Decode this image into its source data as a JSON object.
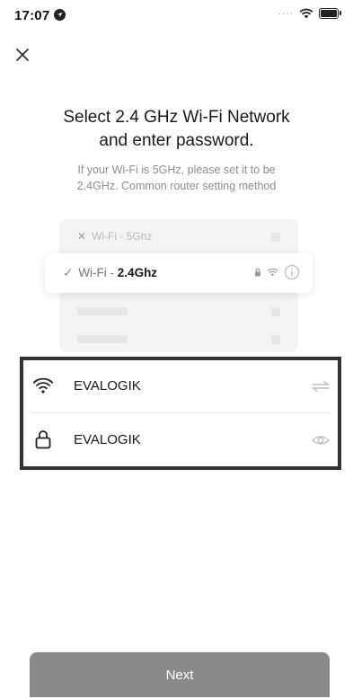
{
  "status_bar": {
    "time": "17:07"
  },
  "title": "Select 2.4 GHz Wi-Fi Network and enter password.",
  "subtitle_line1": "If your Wi-Fi is 5GHz, please set it to be",
  "subtitle_line2": "2.4GHz. Common router setting method",
  "illustration": {
    "network_5g_prefix": "Wi-Fi - ",
    "network_5g_band": "5Ghz",
    "network_24_prefix": "Wi-Fi - ",
    "network_24_band": "2.4Ghz"
  },
  "wifi_field": {
    "value": "EVALOGIK",
    "icon": "wifi-icon",
    "action_icon": "switch-network-icon"
  },
  "password_field": {
    "value": "EVALOGIK",
    "icon": "lock-icon",
    "action_icon": "eye-icon"
  },
  "next_button": {
    "label": "Next"
  }
}
